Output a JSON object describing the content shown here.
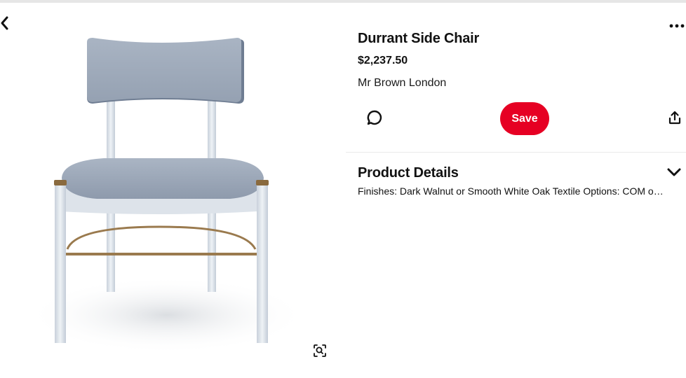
{
  "nav": {
    "back_icon": "chevron-left-icon",
    "more_icon": "ellipsis-icon"
  },
  "pin": {
    "title": "Durrant Side Chair",
    "price": "$2,237.50",
    "seller": "Mr Brown London",
    "image_icon": "visual-search-icon"
  },
  "actions": {
    "comment_icon": "comment-icon",
    "save_label": "Save",
    "share_icon": "share-icon"
  },
  "details": {
    "heading": "Product Details",
    "text": "Finishes: Dark Walnut or Smooth White Oak Textile Options: COM or from the Mr Brown London textile collection",
    "toggle_icon": "chevron-down-icon"
  },
  "colors": {
    "save_button": "#e60023",
    "upholstery": "#9aa6b8",
    "frame": "#dfe5ec",
    "brass": "#9a7a4e"
  }
}
